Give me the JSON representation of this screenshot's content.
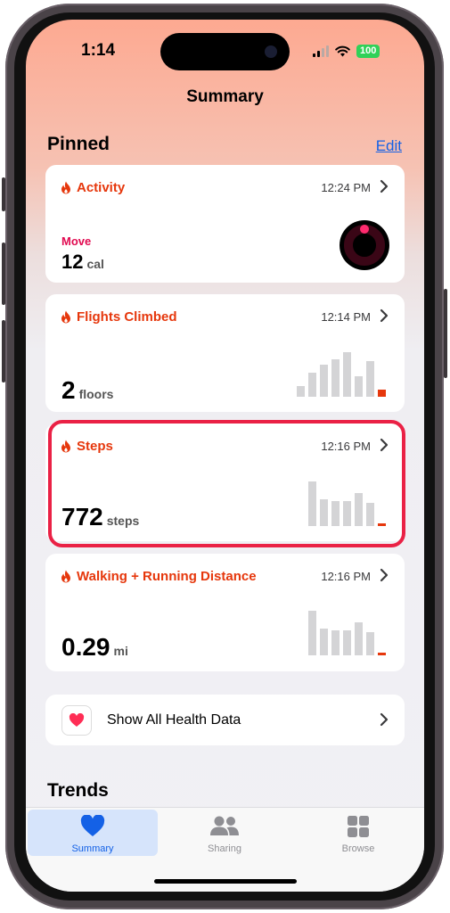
{
  "status_bar": {
    "time": "1:14",
    "battery": "100"
  },
  "nav": {
    "title": "Summary"
  },
  "pinned": {
    "title": "Pinned",
    "edit_label": "Edit"
  },
  "cards": {
    "activity": {
      "title": "Activity",
      "time": "12:24 PM",
      "metric_label": "Move",
      "value": "12",
      "unit": "cal"
    },
    "flights": {
      "title": "Flights Climbed",
      "time": "12:14 PM",
      "value": "2",
      "unit": "floors"
    },
    "steps": {
      "title": "Steps",
      "time": "12:16 PM",
      "value": "772",
      "unit": "steps"
    },
    "distance": {
      "title": "Walking + Running Distance",
      "time": "12:16 PM",
      "value": "0.29",
      "unit": "mi"
    }
  },
  "show_all": {
    "label": "Show All Health Data"
  },
  "trends": {
    "title": "Trends"
  },
  "tabbar": {
    "summary": "Summary",
    "sharing": "Sharing",
    "browse": "Browse"
  },
  "colors": {
    "accent_orange": "#e6370c",
    "move_red": "#e10a50",
    "highlight": "#ea2145",
    "tab_active": "#1461e6",
    "tab_inactive": "#8e8e93"
  },
  "icons": {
    "card_icon": "flame-icon",
    "chevron": "chevron-right-icon",
    "show_all": "heart-icon",
    "tab_summary": "heart-icon",
    "tab_sharing": "people-icon",
    "tab_browse": "grid-icon"
  }
}
